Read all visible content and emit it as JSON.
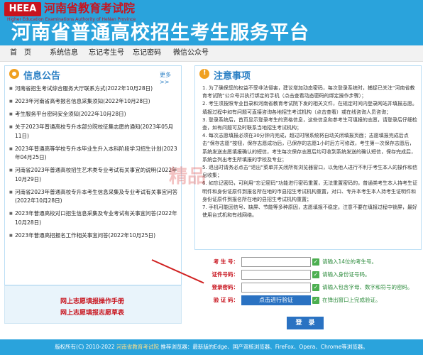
{
  "header": {
    "logo_text": "HEEA",
    "org_cn": "河南省教育考试院",
    "org_en": "Higher Education Examinations Authority of HeNan Province",
    "title": "河南省普通高校招生考生服务平台"
  },
  "nav": {
    "items": [
      "首　页",
      "系统信息",
      "忘记考生号",
      "忘记密码",
      "微信公众号"
    ]
  },
  "notice": {
    "title": "信息公告",
    "more": "更多 >>",
    "items": [
      "河南省招生考试综合服务大厅联系方式(2022年10月28日)",
      "2023年河南省高考报名信息采集须知(2022年10月28日)",
      "考生服务平台密码安全须知(2022年10月28日)",
      "关于2023年普通高校专升本部分院校征集志愿的通知(2023年05月11日)",
      "2023年普通高等学校专升本毕业生升入本科阶段学习招生计划(2023年04月25日)",
      "河南省2023年普通高校招生艺术类专业考试有关事宜的说明(2022年10月29日)",
      "河南省2023年普通高校专升本考生信息采集及专业考试有关事宜问答(2022年10月28日)",
      "2023年普通高校对口招生信息采集及专业考试有关事宜问答(2022年10月28日)",
      "2023年普通高招报名工作相关事宜问答(2022年10月25日)"
    ]
  },
  "guide": {
    "manual": "网上志愿填报操作手册",
    "sheet": "网上志愿填报志愿草表"
  },
  "warnings": {
    "title": "注意事项",
    "items": [
      "1. 为了确保您的权益不受非法侵害，建议增加动态密码，每次登录系统时，捕捉已关注“河南省教育考试院”公众号并执行绑定的手机（点击查看动态密码的绑定操作步骤）；",
      "2. 考生须按照专业目录和河南省教育考试院下发的相关文件，在规定时间内登录网站并填报志愿。填报过程中如有问题可直接咨询各地招生考试机构（点击查看）或在线咨询人员咨询；",
      "3. 登录系统后，首页显示登录考生的资格信息，这些信息和参考生可填报的志愿，请登录后仔细检查，如有问题可及时联系当地招生考试机构；",
      "4. 每次志愿填报必须在30分钟内完成，超过时限系统将自动关闭填报页面；志愿填报完成后点击“保存志愿”按钮，保存志愿成功后，已保存的志愿1小时后方可修改，考生第一次保存志愿后，系统发送志愿填报确认的短信，考生每次保存志愿后均可收到系统发送的确认短信，保存完成后，系统会列出考生所填报的学校及专业；",
      "5. 退出时请务必点击“退出”菜单并关闭所有浏览器窗口，以免他人进行不利于考生本人的操作和信息收集；",
      "6. 如忘记密码，可利用“忘记密码”功能进行密码重置，无法重置密码的，普通类考生本人持考生证明件和身份证原件到报名所在地的市县招生考试机构重置，对口、专升本考生本人持考生证明件和身份证原件到报名所在地的县招生考试机构重置；",
      "7. 手机可能因信号、缺屏、节能等多种原因，志愿填报不稳定。注意不要在填报过程中锁屏，最好使用台式机和有线网络。"
    ]
  },
  "form": {
    "id_label": "考 生 号：",
    "id_hint": "请输入14位的考生号。",
    "card_label": "证件号码：",
    "card_hint": "请输入身份证号码。",
    "pwd_label": "登录密码：",
    "pwd_hint": "请输入包含字母、数字和符号的密码。",
    "verify_label": "验 证 码：",
    "verify_button": "点击进行验证",
    "verify_hint": "在弹出窗口上完成验证。",
    "login_button": "登　录"
  },
  "watermark": "精品",
  "footer": {
    "copyright": "版权所有(C) 2010-2022",
    "org_link": "河南省教育考试院",
    "browsers": "推荐浏览器：最新版的Edge、国产双核浏览器、FireFox、Opera、Chrome等浏览器。"
  }
}
